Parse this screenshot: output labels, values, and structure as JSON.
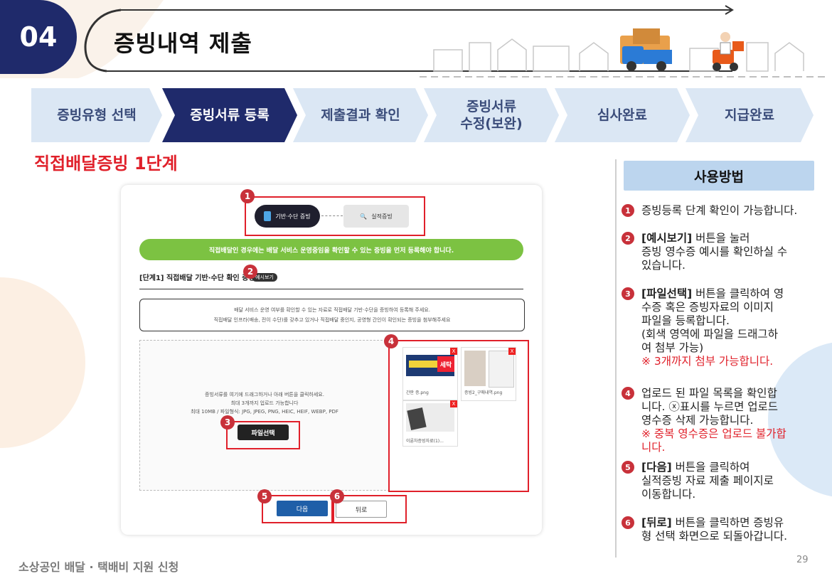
{
  "header": {
    "section_number": "04",
    "section_title": "증빙내역 제출"
  },
  "steps": [
    {
      "label": "증빙유형 선택",
      "active": false
    },
    {
      "label": "증빙서류 등록",
      "active": true
    },
    {
      "label": "제출결과 확인",
      "active": false
    },
    {
      "label": "증빙서류\n수정(보완)",
      "active": false
    },
    {
      "label": "심사완료",
      "active": false
    },
    {
      "label": "지급완료",
      "active": false
    }
  ],
  "stage_title": "직접배달증빙 1단계",
  "screen": {
    "tab_basic": "기반·수단 증빙",
    "tab_perf": "실적증빙",
    "banner": "직접배달인 경우에는 배달 서비스 운영중임을 확인할 수 있는 증빙을 먼저 등록해야 합니다.",
    "step_heading": "[단계1] 직접배달 기반·수단 확인 증빙",
    "example_button": "예시보기",
    "info_line1": "배달 서비스 운영 여부를 확인할 수 있는 자료로 직접배달 기반·수단을 증빙하여 등록해 주세요.",
    "info_line2": "직접배달 인프라(배송, 전이 수단)를 갖추고 있거나 직접배달 중인지, 공영형 간인이 확인되는 증빙을 첨부해주세요",
    "drop_line1": "증빙서류를 여기에 드래그하거나 아래 버튼을 클릭하세요.",
    "drop_line2": "최대 3개까지 업로드 가능합니다",
    "drop_line3": "최대 10MB / 파일형식: JPG, JPEG, PNG, HEIC, HEIF, WEBP, PDF",
    "file_select_button": "파일선택",
    "thumbs": [
      {
        "caption": "간판 증.png",
        "sign_text": "세탁"
      },
      {
        "caption": "증빙2_구매내역.png"
      },
      {
        "caption": "이륜차증빙자료(1)..."
      }
    ],
    "delete_mark": "X",
    "next_button": "다음",
    "back_button": "뒤로",
    "markers": [
      "1",
      "2",
      "3",
      "4",
      "5",
      "6"
    ]
  },
  "howto": {
    "title": "사용방법",
    "items": [
      {
        "num": "1",
        "bold": "",
        "text": "증빙등록 단계 확인이 가능합니다.",
        "note": ""
      },
      {
        "num": "2",
        "bold": "[예시보기]",
        "text": " 버튼을 눌러\n증빙 영수증 예시를 확인하실 수\n있습니다.",
        "note": ""
      },
      {
        "num": "3",
        "bold": "[파일선택]",
        "text": " 버튼을 클릭하여 영\n수증 혹은 증빙자료의 이미지\n파일을 등록합니다.\n(회색 영역에 파일을 드래그하\n여 첨부 가능)",
        "note": "※ 3개까지 첨부 가능합니다."
      },
      {
        "num": "4",
        "bold": "",
        "text": "업로드 된 파일 목록을 확인합\n니다. ⓧ표시를 누르면 업로드\n영수증 삭제 가능합니다.",
        "note": "※ 중복 영수증은 업로드 불가합\n니다."
      },
      {
        "num": "5",
        "bold": "[다음]",
        "text": " 버튼을 클릭하여\n실적증빙 자료 제출 페이지로\n이동합니다.",
        "note": ""
      },
      {
        "num": "6",
        "bold": "[뒤로]",
        "text": " 버튼을 클릭하면 증빙유\n형 선택 화면으로 되돌아갑니다.",
        "note": ""
      }
    ]
  },
  "footer": {
    "text": "소상공인 배달 · 택배비 지원 신청",
    "page_number": "29"
  },
  "colors": {
    "navy": "#1f2a6b",
    "step_inactive": "#dbe7f4",
    "red": "#e0202a",
    "banner_green": "#7cc242",
    "howto_bg": "#bcd5ee",
    "marker_red": "#c8313a"
  }
}
